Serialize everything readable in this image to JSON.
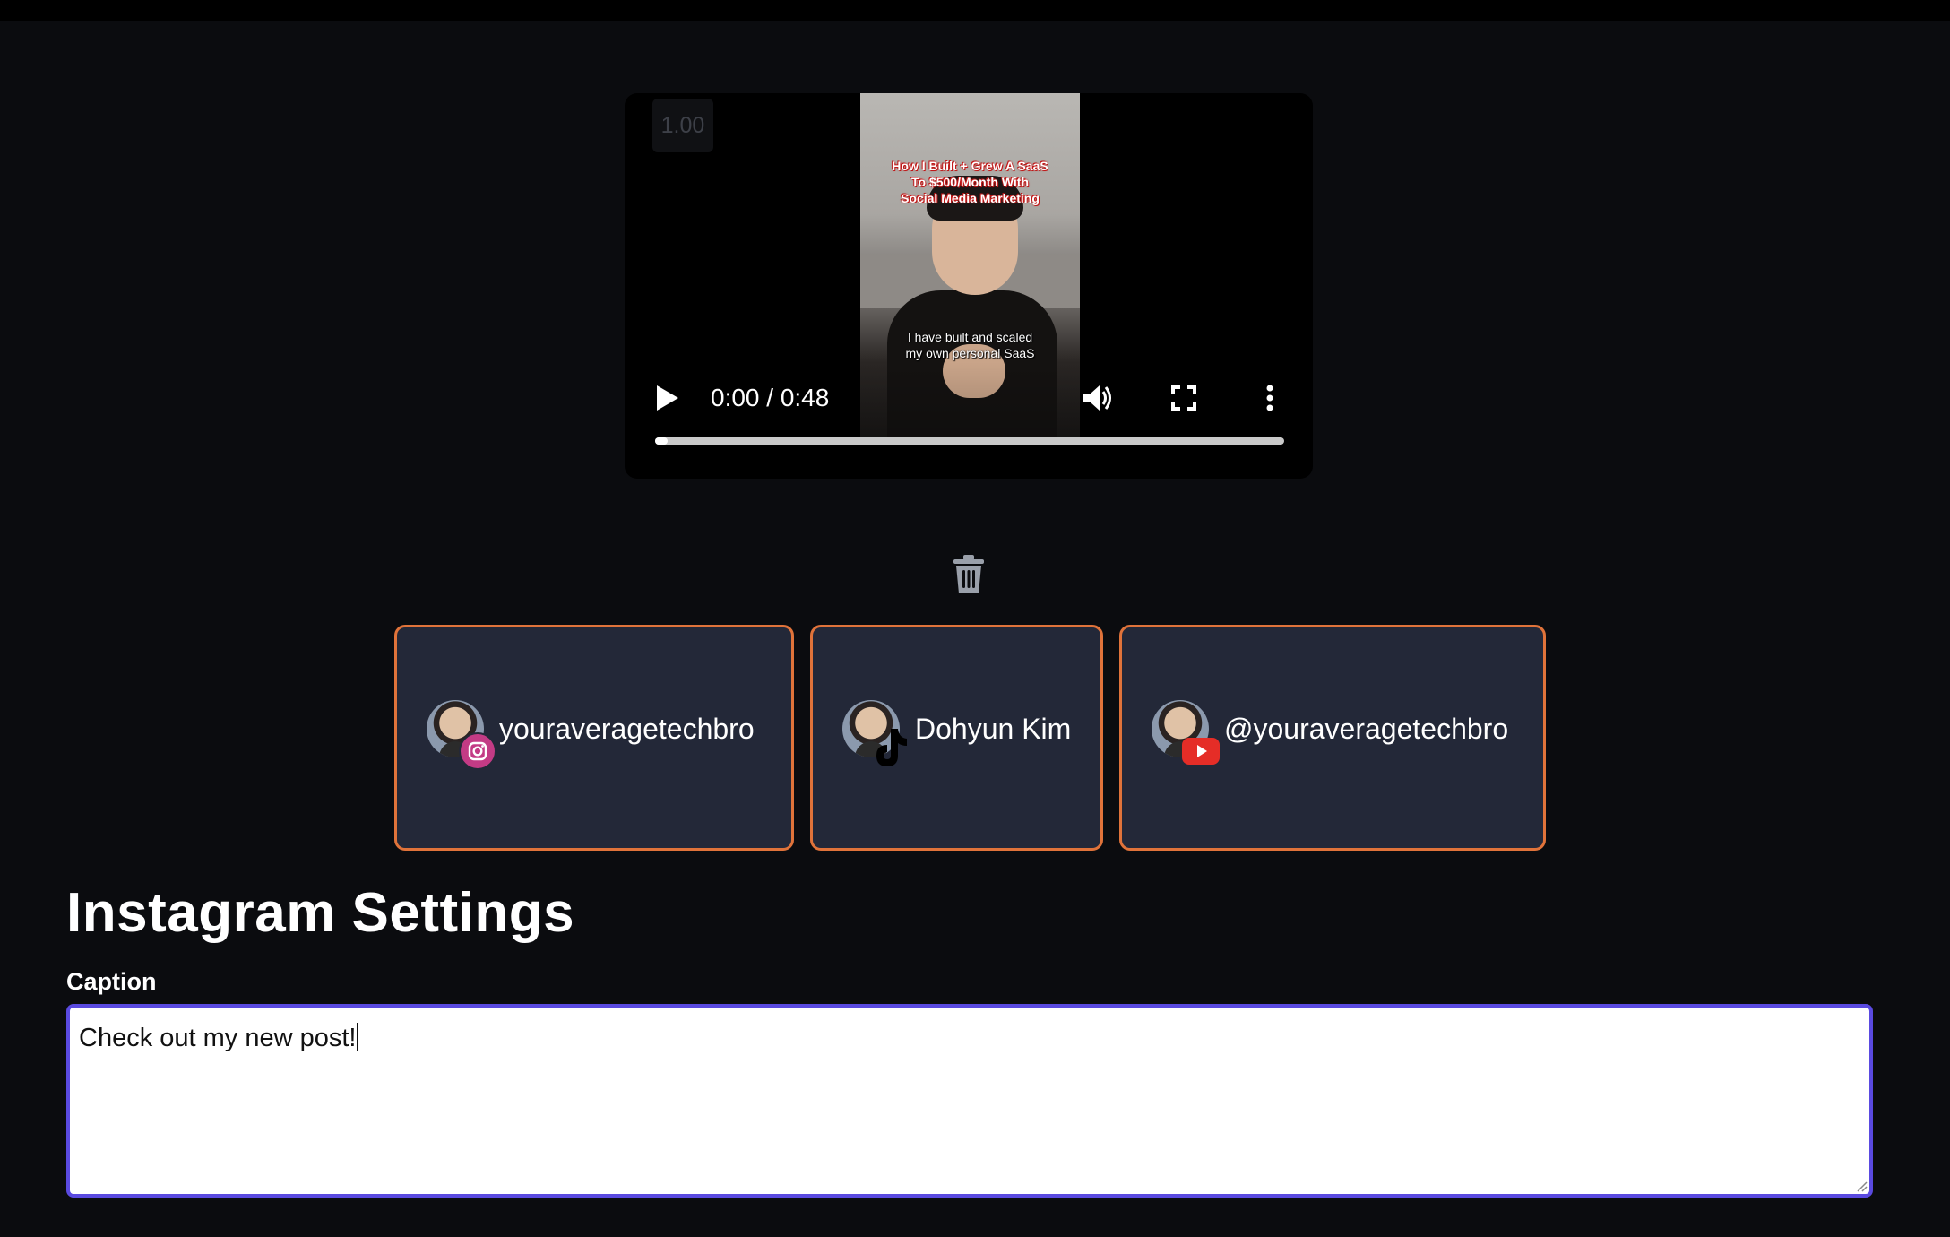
{
  "playback_speed": "1.00",
  "video": {
    "overlay_title_lines": [
      "How I Built + Grew A SaaS",
      "To $500/Month With",
      "Social Media Marketing"
    ],
    "overlay_caption_lines": [
      "I have built and scaled",
      "my own personal SaaS"
    ],
    "time_display": "0:00 / 0:48",
    "progress_fraction": 0.0,
    "controls": {
      "play_icon": "play-icon",
      "volume_icon": "volume-icon",
      "fullscreen_icon": "fullscreen-icon",
      "more_icon": "more-vertical-icon"
    }
  },
  "delete_icon": "trash-icon",
  "accounts": [
    {
      "name": "youraveragetechbro",
      "platform": "instagram"
    },
    {
      "name": "Dohyun Kim",
      "platform": "tiktok"
    },
    {
      "name": "@youraveragetechbro",
      "platform": "youtube"
    }
  ],
  "colors": {
    "accent_border": "#e0733a",
    "card_bg": "#232838",
    "focus_border": "#5a4ae0"
  },
  "settings": {
    "title": "Instagram Settings",
    "caption_label": "Caption",
    "caption_value": "Check out my new post!"
  }
}
